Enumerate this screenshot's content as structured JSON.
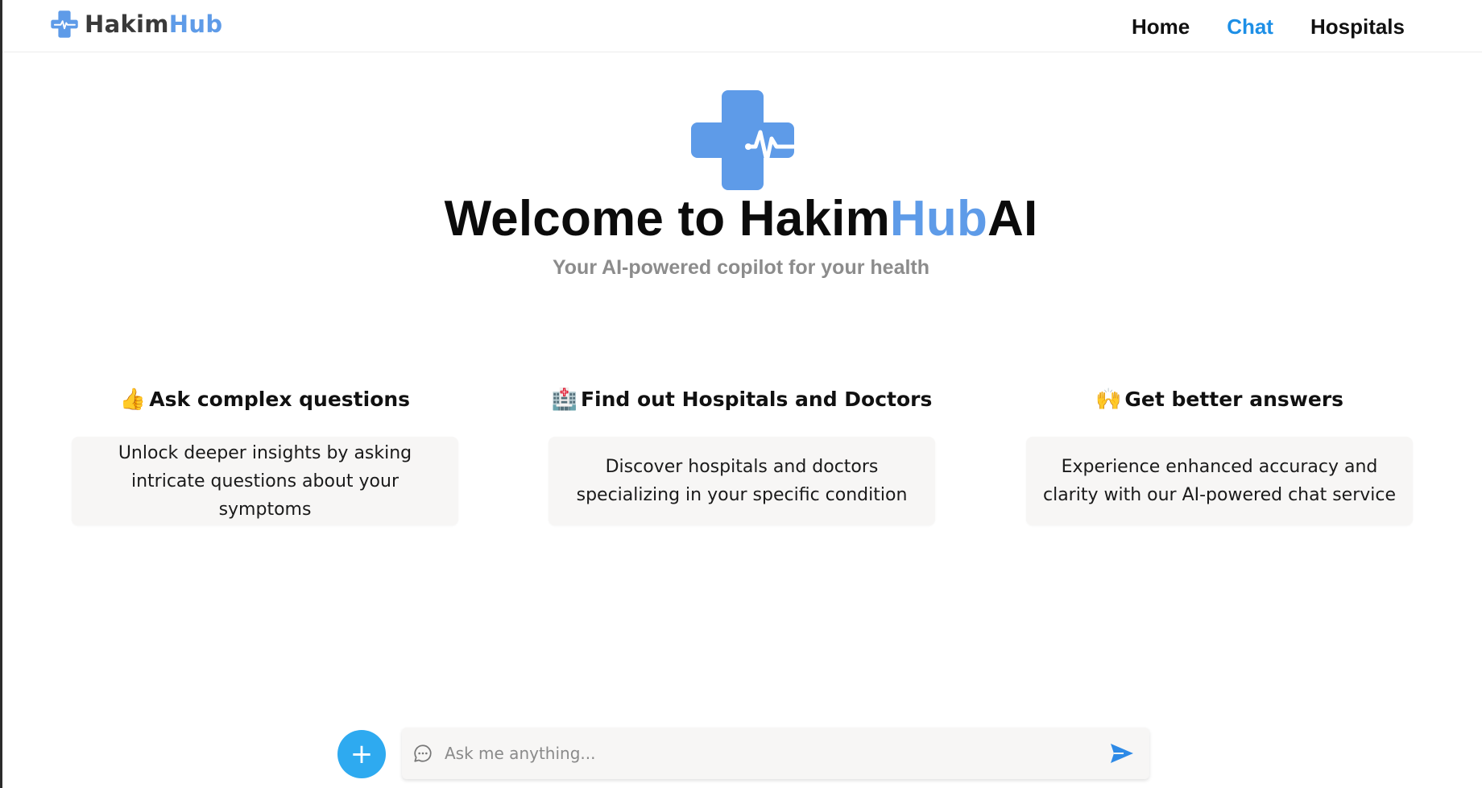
{
  "brand": {
    "name_primary": "Hakim",
    "name_accent": "Hub",
    "logo_icon": "medical-cross-heartbeat-icon",
    "accent_color": "#5e9be8"
  },
  "nav": {
    "items": [
      {
        "label": "Home",
        "active": false
      },
      {
        "label": "Chat",
        "active": true
      },
      {
        "label": "Hospitals",
        "active": false
      }
    ],
    "active_color": "#1d8fe6"
  },
  "hero": {
    "title_primary": "Welcome to Hakim",
    "title_accent": "Hub",
    "title_suffix": "AI",
    "subtitle": "Your AI-powered copilot for your health"
  },
  "features": [
    {
      "emoji": "👍",
      "icon": "thumbs-up-icon",
      "title": "Ask complex questions",
      "description": "Unlock deeper insights by asking intricate questions about your symptoms"
    },
    {
      "emoji": "🏥",
      "icon": "hospital-icon",
      "title": "Find out Hospitals and Doctors",
      "description": "Discover hospitals and doctors specializing in your specific condition"
    },
    {
      "emoji": "🙌",
      "icon": "raised-hands-icon",
      "title": "Get better answers",
      "description": "Experience enhanced accuracy and clarity with our AI-powered chat service"
    }
  ],
  "chat": {
    "add_label": "+",
    "placeholder": "Ask me anything...",
    "value": "",
    "add_button_color": "#2eaaf0",
    "send_color": "#2e8ae6"
  }
}
